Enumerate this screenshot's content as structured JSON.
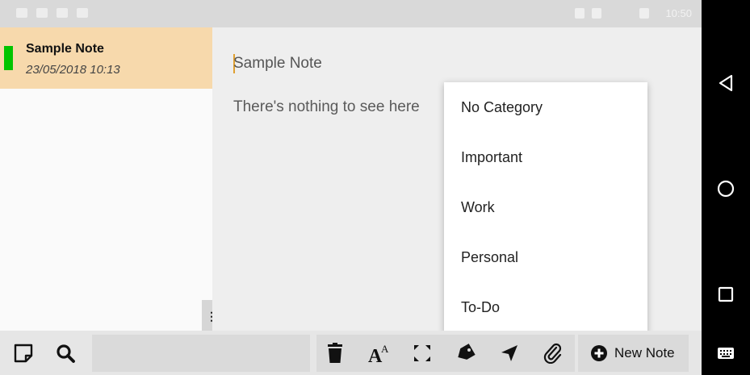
{
  "status_bar": {
    "time": "10:50"
  },
  "sidebar": {
    "notes": [
      {
        "title": "Sample Note",
        "date": "23/05/2018 10:13",
        "category_color": "#00c400",
        "highlight_color": "#f7d9ac"
      }
    ],
    "handle_label": "⋮"
  },
  "editor": {
    "title": "Sample Note",
    "body": "There's nothing to see here"
  },
  "category_menu": {
    "items": [
      "No Category",
      "Important",
      "Work",
      "Personal",
      "To-Do"
    ]
  },
  "toolbar": {
    "left_icons": [
      "note-icon",
      "search-icon"
    ],
    "action_icons": [
      "trash-icon",
      "font-size-icon",
      "fullscreen-icon",
      "tag-icon",
      "send-icon",
      "attach-icon"
    ],
    "new_note_label": "New Note"
  },
  "navbar": {
    "buttons": [
      "back-icon",
      "home-icon",
      "recents-icon",
      "keyboard-icon"
    ]
  }
}
